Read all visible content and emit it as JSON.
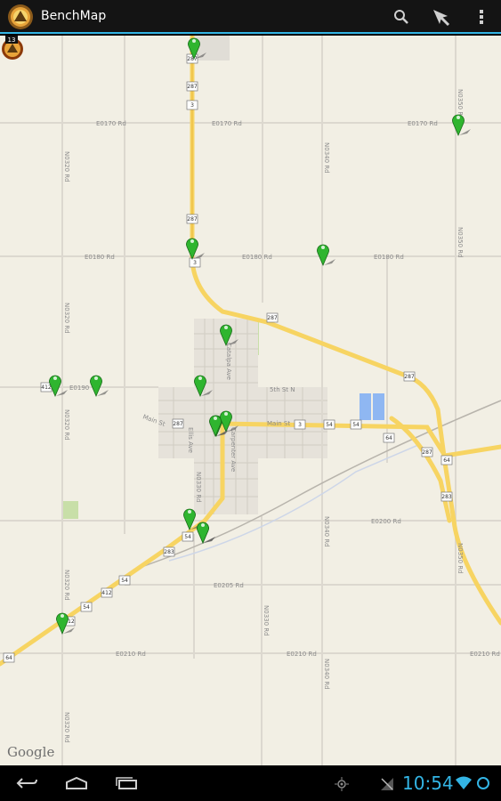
{
  "app": {
    "title": "BenchMap",
    "icon": "benchmark-logo-icon"
  },
  "action_bar": {
    "actions": [
      {
        "name": "search-icon"
      },
      {
        "name": "location-arrow-icon"
      },
      {
        "name": "overflow-menu-icon"
      }
    ],
    "accent": "#33b5e5"
  },
  "map": {
    "attribution": "Google",
    "road_labels": {
      "e0170_left": "E0170 Rd",
      "e0170_right": "E0170 Rd",
      "e0180_left": "E0180 Rd",
      "e0180_mid": "E0180 Rd",
      "e0180_right": "E0180 Rd",
      "e0190": "E0190",
      "e0200": "E0200 Rd",
      "e0205": "E0205 Rd",
      "e0210_left": "E0210 Rd",
      "e0210_mid": "E0210 Rd",
      "e0210_right": "E0210 Rd",
      "main_st": "Main St",
      "main_st_left": "Main St",
      "fifth_st": "5th St N",
      "catalpa": "Catalpa Ave",
      "carpenter": "Carpenter Ave",
      "ellis": "Ellis Ave",
      "n0320": "N0320 Rd",
      "n0330": "N0330 Rd",
      "n0340": "N0340 Rd",
      "n0370": "N0370 Rd",
      "n0360": "N0360 Rd",
      "n0350": "N0350 Rd"
    },
    "shields": [
      "287",
      "287",
      "287",
      "287",
      "287",
      "3",
      "3",
      "54",
      "54",
      "287",
      "287",
      "64",
      "412",
      "64",
      "54",
      "54",
      "283",
      "412",
      "412",
      "54",
      "3",
      "64"
    ],
    "marker_color": "#2fb52f",
    "marker_count": 15,
    "badge_number": "13"
  },
  "nav_bar": {
    "buttons": [
      {
        "name": "back-icon"
      },
      {
        "name": "home-icon"
      },
      {
        "name": "recent-apps-icon"
      }
    ],
    "status_icons": [
      "gps-icon",
      "no-signal-icon",
      "wifi-icon",
      "sync-icon"
    ],
    "clock": "10:54"
  }
}
